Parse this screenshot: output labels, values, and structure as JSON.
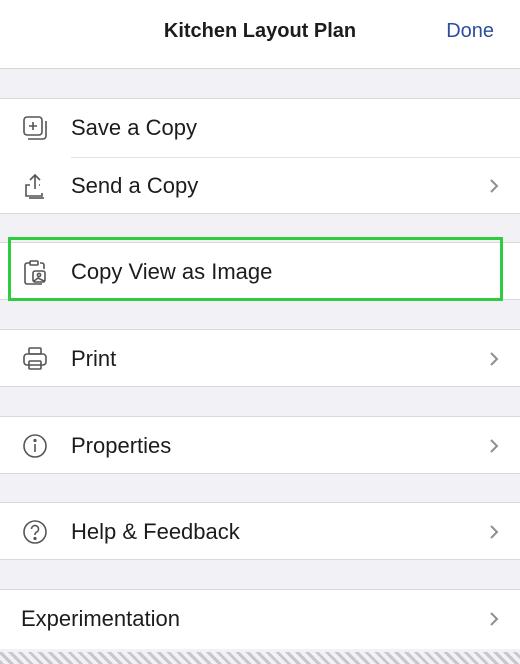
{
  "header": {
    "title": "Kitchen Layout Plan",
    "done_label": "Done"
  },
  "colors": {
    "accent": "#2e4d9e",
    "highlight": "#2ecc40"
  },
  "menu": {
    "save_copy": {
      "label": "Save a Copy",
      "icon": "save-copy-icon"
    },
    "send_copy": {
      "label": "Send a Copy",
      "icon": "share-icon"
    },
    "copy_view": {
      "label": "Copy View as Image",
      "icon": "clipboard-image-icon"
    },
    "print": {
      "label": "Print",
      "icon": "printer-icon"
    },
    "properties": {
      "label": "Properties",
      "icon": "info-icon"
    },
    "help": {
      "label": "Help & Feedback",
      "icon": "help-icon"
    },
    "experimentation": {
      "label": "Experimentation"
    }
  }
}
